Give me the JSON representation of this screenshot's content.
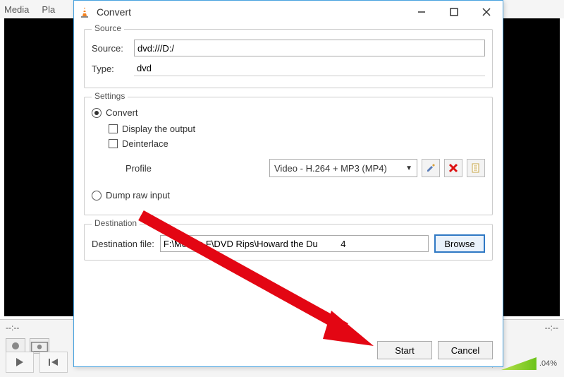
{
  "bg": {
    "menu_media": "Media",
    "menu_playback": "Pla",
    "time_left": "--:--",
    "time_right": "--:--",
    "volume_pct": ".04%"
  },
  "dialog": {
    "title": "Convert",
    "source": {
      "group": "Source",
      "label_source": "Source:",
      "value_source": "dvd:///D:/",
      "label_type": "Type:",
      "value_type": "dvd"
    },
    "settings": {
      "group": "Settings",
      "opt_convert": "Convert",
      "opt_display": "Display the output",
      "opt_deinterlace": "Deinterlace",
      "label_profile": "Profile",
      "profile_value": "Video - H.264 + MP3 (MP4)",
      "opt_dump": "Dump raw input"
    },
    "destination": {
      "group": "Destination",
      "label": "Destination file:",
      "value": "F:\\Movies F\\DVD Rips\\Howard the Du         4",
      "browse": "Browse"
    },
    "buttons": {
      "start": "Start",
      "cancel": "Cancel"
    }
  }
}
